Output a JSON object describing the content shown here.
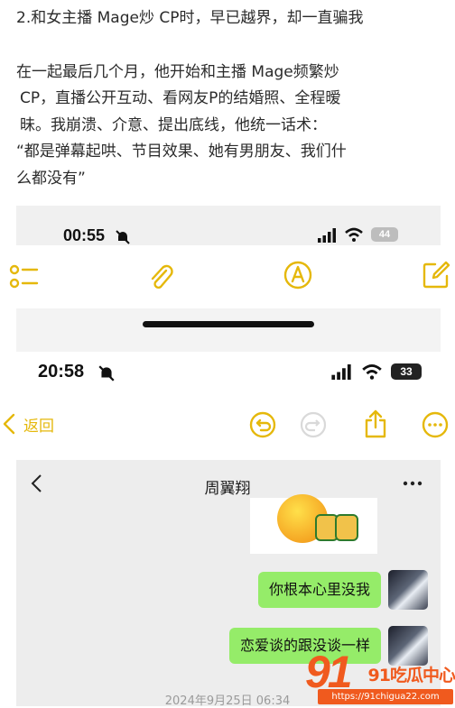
{
  "article": {
    "heading": "2.和女主播 Mage炒 CP时，早已越界，却一直骗我",
    "lines": [
      "在一起最后几个月，他开始和主播 Mage频繁炒",
      "CP，直播公开互动、看网友P的结婚照、全程暧",
      "昧。我崩溃、介意、提出底线，他统一话术：",
      "“都是弹幕起哄、节目效果、她有男朋友、我们什",
      "么都没有”"
    ]
  },
  "screenshot1": {
    "time": "00:55",
    "battery": "44"
  },
  "screenshot2": {
    "time": "20:58",
    "battery": "33",
    "back_label": "返回",
    "chat_title": "周翼翔",
    "messages": [
      "你根本心里没我",
      "恋爱谈的跟没谈一样"
    ],
    "timestamp": "2024年9月25日 06:34"
  },
  "watermark": {
    "brand": "91吃瓜中心",
    "url": "https://91chigua22.com"
  },
  "colors": {
    "accent": "#e5b80b",
    "bubble": "#95ec69",
    "chat_bg": "#ededed"
  }
}
